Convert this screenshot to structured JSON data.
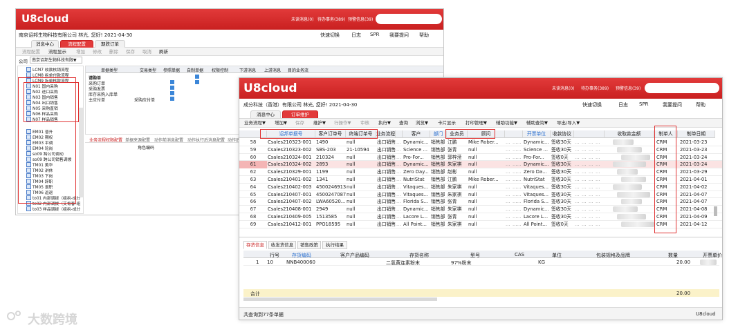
{
  "app": {
    "logo": "U8cloud"
  },
  "back_window": {
    "topbar": {
      "unread": "未读消息(0)",
      "todo": "待办事务(389)",
      "reminder": "预警信息(39)"
    },
    "company_greeting": "南京诏邦生物科技有限公司 林光, 您好! 2021-04-30",
    "links": {
      "quick_switch": "快速切换",
      "log": "日志",
      "spr": "SPR",
      "feedback": "我要提问",
      "help": "帮助"
    },
    "tabs": [
      "消息中心",
      "流程配置",
      "期跌订单"
    ],
    "toolbar": [
      "流程配置",
      "流程显示",
      "增加",
      "修改",
      "删除",
      "保存",
      "取消",
      "刷新"
    ],
    "company_label": "公司",
    "company_value": "南京诏邦生物科技有限▼",
    "tree_items_top": [
      "LCM7 收款核销流程",
      "LCM8 拆单付款流程",
      "LCM9 拆单核款流程"
    ],
    "tree_items_boxed": [
      "N01 国内采购",
      "N02 进口采购",
      "N03 国内销售",
      "N04 出口销售",
      "N05 采购直销",
      "N06 样品采购",
      "N07 样品销售"
    ],
    "tree_items_bottom": [
      "EM01 普升",
      "EM02 期权",
      "EM03 平调",
      "EM04 轮岗",
      "so09 跨公司调动",
      "so09 跨公司销售调拨",
      "TM01 美华",
      "TM02 讲休",
      "TM03 下岗",
      "TM04 辞职",
      "TM05 退职",
      "TM06 返退",
      "to01 内部调拨（组拆-成分",
      "to02 内部调拨（艾肯春-组",
      "to03 样品调拨（组拆-成分"
    ],
    "table_headers": [
      "单据类型",
      "交易类型",
      "参照单据",
      "自制单据",
      "权限控制",
      "下游消息",
      "上游消息",
      "目的业务流"
    ],
    "table_rows": [
      "请购单",
      "采购订单",
      "采购发票",
      "库存采购入库单",
      "主应付单"
    ],
    "table_extra": "采购应付单",
    "sub_tabs": [
      "业务流程权限配置",
      "单据来源配置",
      "动作前消息配置",
      "动作执行后消息配置",
      "动作后"
    ],
    "role_code": "角色编码"
  },
  "front_window": {
    "topbar": {
      "unread": "未读消息(0)",
      "todo": "待办事务(389)",
      "reminder": "预警信息(39)"
    },
    "company_greeting": "成分科技（香港）有限公司 林光, 您好! 2021-04-30",
    "links": {
      "quick_switch": "快速切换",
      "log": "日志",
      "spr": "SPR",
      "feedback": "我要提问",
      "help": "帮助"
    },
    "tabs": [
      "消息中心",
      "订单维护"
    ],
    "toolbar": [
      "业务流程▼",
      "增加▼",
      "保存",
      "维护▼",
      "行操作▼",
      "审核",
      "执行▼",
      "查询",
      "浏览▼",
      "卡片显示",
      "打印管理▼",
      "辅助功能▼",
      "辅助查询▼",
      "导出/导入▼"
    ],
    "headers": [
      "诏邦单据号",
      "客户订单号",
      "终端订单号",
      "业务流程",
      "客户",
      "部门",
      "业务员",
      "顾问",
      "开票单位",
      "收款协议",
      "收取款金额",
      "制单人",
      "制单日期"
    ],
    "rows": [
      {
        "n": "58",
        "doc": "Csales210323-001",
        "cust_order": "1490",
        "term": "null",
        "flow": "出口销售",
        "cust": "Dynamic...",
        "dept": "销售部",
        "sales": "江鹏",
        "adv": "Mike Rober...",
        "bill": "Dynamic...",
        "agree": "签收30天",
        "maker": "CRM",
        "date": "2021-03-23"
      },
      {
        "n": "59",
        "doc": "Csales210323-002",
        "cust_order": "SBS-203",
        "term": "21-10594",
        "flow": "出口销售",
        "cust": "Science ...",
        "dept": "销售部",
        "sales": "张青",
        "adv": "null",
        "bill": "Science ...",
        "agree": "签收30天",
        "maker": "CRM",
        "date": "2021-03-23"
      },
      {
        "n": "60",
        "doc": "Csales210324-001",
        "cust_order": "210324",
        "term": "null",
        "flow": "出口销售",
        "cust": "Pro-For...",
        "dept": "销售部",
        "sales": "郭梓滢",
        "adv": "null",
        "bill": "Pro-For...",
        "agree": "签收0天",
        "maker": "CRM",
        "date": "2021-03-24"
      },
      {
        "n": "61",
        "doc": "Csales210324-002",
        "cust_order": "2893",
        "term": "null",
        "flow": "出口销售",
        "cust": "Dynamic...",
        "dept": "销售部",
        "sales": "朱家祺",
        "adv": "null",
        "bill": "Dynamic...",
        "agree": "签收30天",
        "maker": "CRM",
        "date": "2021-03-24"
      },
      {
        "n": "62",
        "doc": "Csales210329-001",
        "cust_order": "1199",
        "term": "null",
        "flow": "出口销售",
        "cust": "Zero Day...",
        "dept": "销售部",
        "sales": "赵彬",
        "adv": "null",
        "bill": "Zero Da...",
        "agree": "签收30天",
        "maker": "CRM",
        "date": "2021-03-29"
      },
      {
        "n": "63",
        "doc": "Csales210401-002",
        "cust_order": "1341",
        "term": "null",
        "flow": "出口销售",
        "cust": "NutriStat",
        "dept": "销售部",
        "sales": "江鹏",
        "adv": "Mike Rober...",
        "bill": "NutriStat",
        "agree": "签收30天",
        "maker": "CRM",
        "date": "2021-04-01"
      },
      {
        "n": "64",
        "doc": "Csales210402-003",
        "cust_order": "4500246913",
        "term": "null",
        "flow": "出口销售",
        "cust": "Vitaques...",
        "dept": "销售部",
        "sales": "朱家祺",
        "adv": "null",
        "bill": "Vitaques...",
        "agree": "签收30天",
        "maker": "CRM",
        "date": "2021-04-02"
      },
      {
        "n": "65",
        "doc": "Csales210407-001",
        "cust_order": "4500247087",
        "term": "null",
        "flow": "出口销售",
        "cust": "Vitaques...",
        "dept": "销售部",
        "sales": "朱家祺",
        "adv": "null",
        "bill": "Vitaques...",
        "agree": "签收30天",
        "maker": "CRM",
        "date": "2021-04-07"
      },
      {
        "n": "66",
        "doc": "Csales210407-002",
        "cust_order": "LWA60520...",
        "term": "null",
        "flow": "出口销售",
        "cust": "Florida S...",
        "dept": "销售部",
        "sales": "张青",
        "adv": "null",
        "bill": "Florida S...",
        "agree": "签收30天",
        "maker": "CRM",
        "date": "2021-04-07"
      },
      {
        "n": "67",
        "doc": "Csales210408-001",
        "cust_order": "2949",
        "term": "null",
        "flow": "出口销售",
        "cust": "Dynamic...",
        "dept": "销售部",
        "sales": "朱家祺",
        "adv": "null",
        "bill": "Dynamic...",
        "agree": "签收30天",
        "maker": "CRM",
        "date": "2021-04-08"
      },
      {
        "n": "68",
        "doc": "Csales210409-005",
        "cust_order": "1513585",
        "term": "null",
        "flow": "出口销售",
        "cust": "Lacore L...",
        "dept": "销售部",
        "sales": "张青",
        "adv": "null",
        "bill": "Lacore L...",
        "agree": "签收30天",
        "maker": "CRM",
        "date": "2021-04-09"
      },
      {
        "n": "69",
        "doc": "Csales210412-001",
        "cust_order": "PPO18595",
        "term": "null",
        "flow": "出口销售",
        "cust": "All Point...",
        "dept": "销售部",
        "sales": "朱家祺",
        "adv": "null",
        "bill": "All Point...",
        "agree": "签收0天",
        "maker": "CRM",
        "date": "2021-04-12"
      }
    ],
    "lower_tabs": [
      "存货信息",
      "收发货信息",
      "销售政策",
      "执行结果"
    ],
    "lower_headers": [
      "行号",
      "存货编码",
      "客户产品编码",
      "存货名称",
      "型号",
      "CAS",
      "单位",
      "包装规格及品牌",
      "数量",
      "开票单价"
    ],
    "lower_row": {
      "idx": "1",
      "line": "10",
      "code": "NNB400060",
      "name": "二氢黄连素粉末",
      "model": "97%粉末",
      "unit": "KG",
      "qty": "20.00"
    },
    "total_label": "合计",
    "total_qty": "20.00",
    "status": "共查询到77条单据",
    "status_right": "U8cloud"
  },
  "watermark": "大数跨境"
}
